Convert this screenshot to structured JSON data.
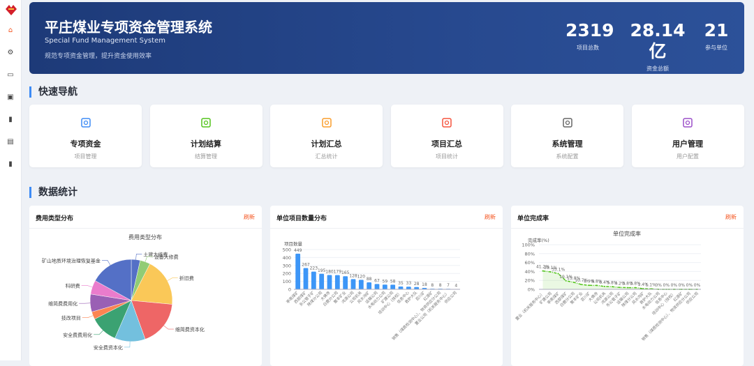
{
  "header": {
    "title": "平庄煤业专项资金管理系统",
    "subtitle": "Special Fund Management System",
    "desc": "规范专项资金管理，提升资金使用效率",
    "stats": [
      {
        "value": "2319",
        "label": "项目总数"
      },
      {
        "value": "28.14亿",
        "label": "资金总额"
      },
      {
        "value": "21",
        "label": "参与单位"
      }
    ]
  },
  "sidebar": {
    "icons": [
      "home-icon",
      "gear-icon",
      "monitor-icon",
      "toolbox-icon",
      "bar-chart-icon",
      "table-icon",
      "statistics-icon"
    ]
  },
  "sections": {
    "nav": "快速导航",
    "stats": "数据统计"
  },
  "nav": [
    {
      "title": "专项资金",
      "sub": "项目管理",
      "color": "#3d8bf5"
    },
    {
      "title": "计划结算",
      "sub": "结算管理",
      "color": "#52c41a"
    },
    {
      "title": "计划汇总",
      "sub": "汇总统计",
      "color": "#fa9d2b"
    },
    {
      "title": "项目汇总",
      "sub": "项目统计",
      "color": "#f5533d"
    },
    {
      "title": "系统管理",
      "sub": "系统配置",
      "color": "#666666"
    },
    {
      "title": "用户管理",
      "sub": "用户配置",
      "color": "#9b4fc9"
    }
  ],
  "cards": [
    {
      "title": "费用类型分布",
      "refresh": "刷新"
    },
    {
      "title": "单位项目数量分布",
      "refresh": "刷新"
    },
    {
      "title": "单位完成率",
      "refresh": "刷新"
    }
  ],
  "chart_data": [
    {
      "type": "pie",
      "title": "费用类型分布",
      "labels": [
        "土建大修费",
        "设备大修费",
        "折旧费",
        "维简费资本化",
        "安全费资本化",
        "安全费费用化",
        "技改项目",
        "维简费费用化",
        "科研费",
        "矿山地质环境治理恢复基金"
      ],
      "values": [
        3.5,
        4,
        19,
        18,
        12,
        11,
        3,
        7,
        5.5,
        17
      ],
      "colors": [
        "#5470c6",
        "#91cc75",
        "#fac858",
        "#ee6666",
        "#73c0de",
        "#3ba272",
        "#fc8452",
        "#9a60b4",
        "#ea7ccc",
        "#5470c6"
      ]
    },
    {
      "type": "bar",
      "title": "",
      "ylabel": "项目数量",
      "ylim": [
        0,
        500
      ],
      "yticks": [
        0,
        100,
        200,
        300,
        400,
        500
      ],
      "categories": [
        "亭南煤矿",
        "西部煤矿",
        "东公管子矿",
        "陕煤分公司",
        "大佛寺",
        "白鹿分公司",
        "聚丰矿业",
        "鸿源公司",
        "公司机关",
        "风水沟矿",
        "运输公司",
        "水电动力公司",
        "矿建公司",
        "培训中心（技校）",
        "信息中心",
        "救护大队",
        "百川矿",
        "红源矿",
        "销售（煤质检测中心）、物资供应分公司",
        "置业公司（机关服务中心）",
        "供应公司"
      ],
      "values": [
        449,
        267,
        223,
        195,
        180,
        179,
        165,
        128,
        120,
        88,
        67,
        59,
        58,
        35,
        33,
        28,
        18,
        8,
        8,
        7,
        4
      ]
    },
    {
      "type": "line",
      "title": "单位完成率",
      "ylabel": "完成率(%)",
      "ylim": [
        0,
        100
      ],
      "yticks": [
        "0%",
        "20%",
        "40%",
        "60%",
        "80%",
        "100%"
      ],
      "categories": [
        "置业（机关服务中心）",
        "矿建公司",
        "亭南煤矿",
        "西部煤矿",
        "白鹿分公司",
        "聚丰矿业",
        "百川矿",
        "大佛寺",
        "公司机关",
        "鸿源公司",
        "东公管子矿",
        "运输公司",
        "陕煤分公司",
        "风水沟矿",
        "救护大队",
        "水电动力公司",
        "信息中心",
        "培训中心（技校）",
        "红源矿",
        "销售（煤质检测中心）、物资供应分公司",
        "供应公司"
      ],
      "values": [
        41.2,
        39.1,
        35.1,
        19.1,
        15.8,
        10.7,
        8.9,
        8.8,
        6.4,
        5.8,
        4.2,
        3.8,
        3.8,
        1.4,
        1.1,
        0,
        0,
        0,
        0,
        0,
        0
      ],
      "labels": [
        "41.2%",
        "39.1%",
        "35.1%",
        "19.1%",
        "15.8%",
        "10.7%",
        "8.9%",
        "8.8%",
        "6.4%",
        "5.8%",
        "4.2%",
        "3.8%",
        "3.8%",
        "1.4%",
        "1.1%",
        "0%",
        "0%",
        "0%",
        "0%",
        "0%",
        "0%"
      ],
      "color": "#52c41a"
    }
  ]
}
